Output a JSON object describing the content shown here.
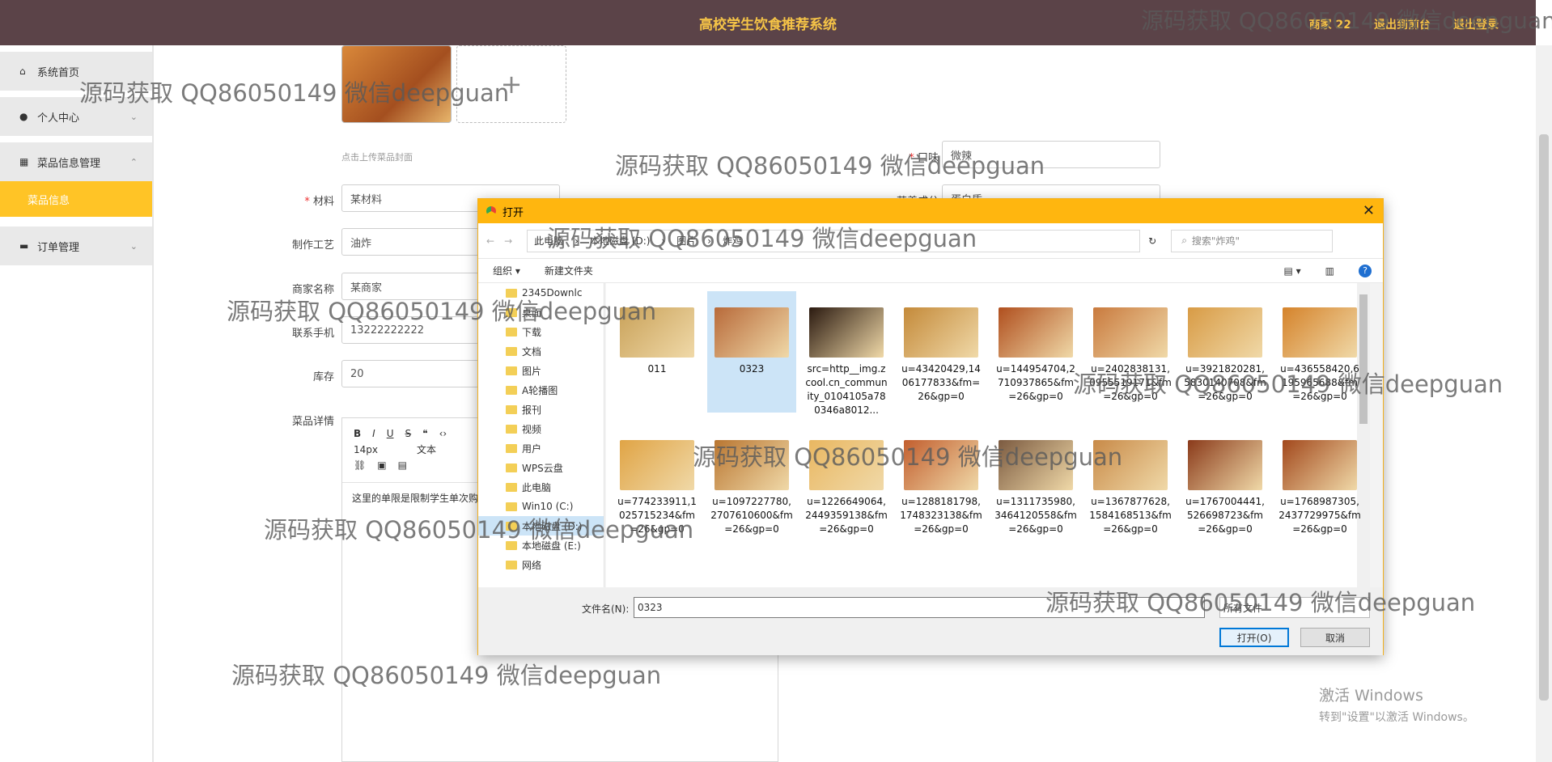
{
  "header": {
    "title": "高校学生饮食推荐系统",
    "user": "商家 22",
    "exit_front": "退出到前台",
    "logout": "退出登录"
  },
  "sidebar": {
    "home": "系统首页",
    "profile": "个人中心",
    "dish_mgmt": "菜品信息管理",
    "dish_info": "菜品信息",
    "orders": "订单管理"
  },
  "form": {
    "upload_hint": "点击上传菜品封面",
    "material_label": "材料",
    "material_value": "某材料",
    "process_label": "制作工艺",
    "process_value": "油炸",
    "merchant_label": "商家名称",
    "merchant_value": "某商家",
    "phone_label": "联系手机",
    "phone_value": "13222222222",
    "stock_label": "库存",
    "stock_value": "20",
    "detail_label": "菜品详情",
    "taste_label": "口味",
    "taste_value": "微辣",
    "nutrition_label": "营养成分",
    "nutrition_value": "蛋白质",
    "editor_font_size": "14px",
    "editor_format": "文本",
    "editor_text": "这里的单限是限制学生单次购"
  },
  "dialog": {
    "title": "打开",
    "address": [
      "此电脑",
      "本地磁盘 (D:)",
      "图片",
      "炸鸡"
    ],
    "search_placeholder": "搜索\"炸鸡\"",
    "organize": "组织 ▾",
    "new_folder": "新建文件夹",
    "tree": [
      "2345Downlc",
      "桌面",
      "下载",
      "文档",
      "图片",
      "A轮播图",
      "报刊",
      "视频",
      "用户",
      "WPS云盘",
      "此电脑",
      "Win10 (C:)",
      "本地磁盘 (D:)",
      "本地磁盘 (E:)",
      "网络"
    ],
    "files": [
      {
        "name": "011",
        "color": "#c9a25a"
      },
      {
        "name": "0323",
        "color": "#b86a3a"
      },
      {
        "name": "src=http__img.zcool.cn_community_0104105a780346a8012...",
        "color": "#2b1a10"
      },
      {
        "name": "u=43420429,1406177833&fm=26&gp=0",
        "color": "#c48a3a"
      },
      {
        "name": "u=144954704,2710937865&fm=26&gp=0",
        "color": "#b04f1e"
      },
      {
        "name": "u=2402838131,0955519171&fm=26&gp=0",
        "color": "#c97a3e"
      },
      {
        "name": "u=3921820281,5830140708&fm=26&gp=0",
        "color": "#d89b45"
      },
      {
        "name": "u=436558420,6195965688&fm=26&gp=0",
        "color": "#d5832b"
      },
      {
        "name": "u=774233911,1025715234&fm=26&gp=0",
        "color": "#e0a445"
      },
      {
        "name": "u=1097227780,2707610600&fm=26&gp=0",
        "color": "#b97631"
      },
      {
        "name": "u=1226649064,2449359138&fm=26&gp=0",
        "color": "#e9b761"
      },
      {
        "name": "u=1288181798,1748323138&fm=26&gp=0",
        "color": "#c25e2e"
      },
      {
        "name": "u=1311735980,3464120558&fm=26&gp=0",
        "color": "#7b5a40"
      },
      {
        "name": "u=1367877628,1584168513&fm=26&gp=0",
        "color": "#c88a48"
      },
      {
        "name": "u=1767004441,526698723&fm=26&gp=0",
        "color": "#8a3a1a"
      },
      {
        "name": "u=1768987305,2437729975&fm=26&gp=0",
        "color": "#a2481c"
      }
    ],
    "filename_label": "文件名(N):",
    "filename_value": "0323",
    "filetype": "所有文件",
    "open": "打开(O)",
    "cancel": "取消"
  },
  "watermark": "源码获取 QQ86050149 微信deepguan",
  "activate": {
    "line1": "激活 Windows",
    "line2": "转到\"设置\"以激活 Windows。"
  }
}
